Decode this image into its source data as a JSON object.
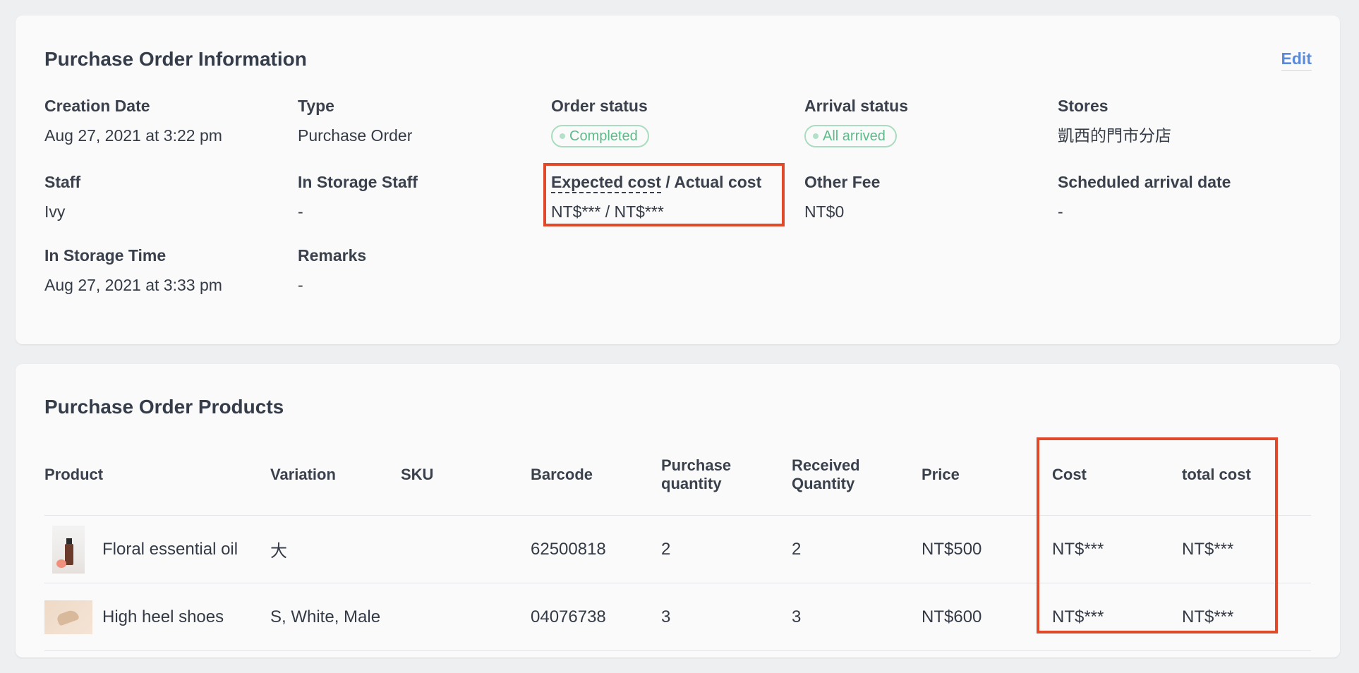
{
  "info": {
    "title": "Purchase Order Information",
    "edit_label": "Edit",
    "creation_date": {
      "label": "Creation Date",
      "value": "Aug 27, 2021 at 3:22 pm"
    },
    "type": {
      "label": "Type",
      "value": "Purchase Order"
    },
    "order_status": {
      "label": "Order status",
      "value": "Completed",
      "color": "#5dbb89"
    },
    "arrival_status": {
      "label": "Arrival status",
      "value": "All arrived",
      "color": "#5dbb89"
    },
    "stores": {
      "label": "Stores",
      "value": "凱西的門市分店"
    },
    "staff": {
      "label": "Staff",
      "value": "Ivy"
    },
    "in_storage_staff": {
      "label": "In Storage Staff",
      "value": "-"
    },
    "cost": {
      "label_expected": "Expected cost",
      "label_sep": " / Actual cost",
      "value": "NT$*** / NT$***"
    },
    "other_fee": {
      "label": "Other Fee",
      "value": "NT$0"
    },
    "scheduled_arrival": {
      "label": "Scheduled arrival date",
      "value": "-"
    },
    "in_storage_time": {
      "label": "In Storage Time",
      "value": "Aug 27, 2021 at 3:33 pm"
    },
    "remarks": {
      "label": "Remarks",
      "value": "-"
    }
  },
  "products": {
    "title": "Purchase Order Products",
    "columns": {
      "product": "Product",
      "variation": "Variation",
      "sku": "SKU",
      "barcode": "Barcode",
      "purchase_qty_1": "Purchase",
      "purchase_qty_2": "quantity",
      "received_qty_1": "Received",
      "received_qty_2": "Quantity",
      "price": "Price",
      "cost": "Cost",
      "total_cost": "total cost"
    },
    "rows": [
      {
        "image_icon": "essential-oil-thumbnail",
        "product": "Floral essential oil",
        "variation": "大",
        "sku": "",
        "barcode": "62500818",
        "purchase_qty": "2",
        "received_qty": "2",
        "price": "NT$500",
        "cost": "NT$***",
        "total_cost": "NT$***"
      },
      {
        "image_icon": "high-heel-shoes-thumbnail",
        "product": "High heel shoes",
        "variation": "S, White, Male",
        "sku": "",
        "barcode": "04076738",
        "purchase_qty": "3",
        "received_qty": "3",
        "price": "NT$600",
        "cost": "NT$***",
        "total_cost": "NT$***"
      }
    ]
  },
  "accent_color": "#5b8ad9",
  "highlight_color": "#e04a2a"
}
